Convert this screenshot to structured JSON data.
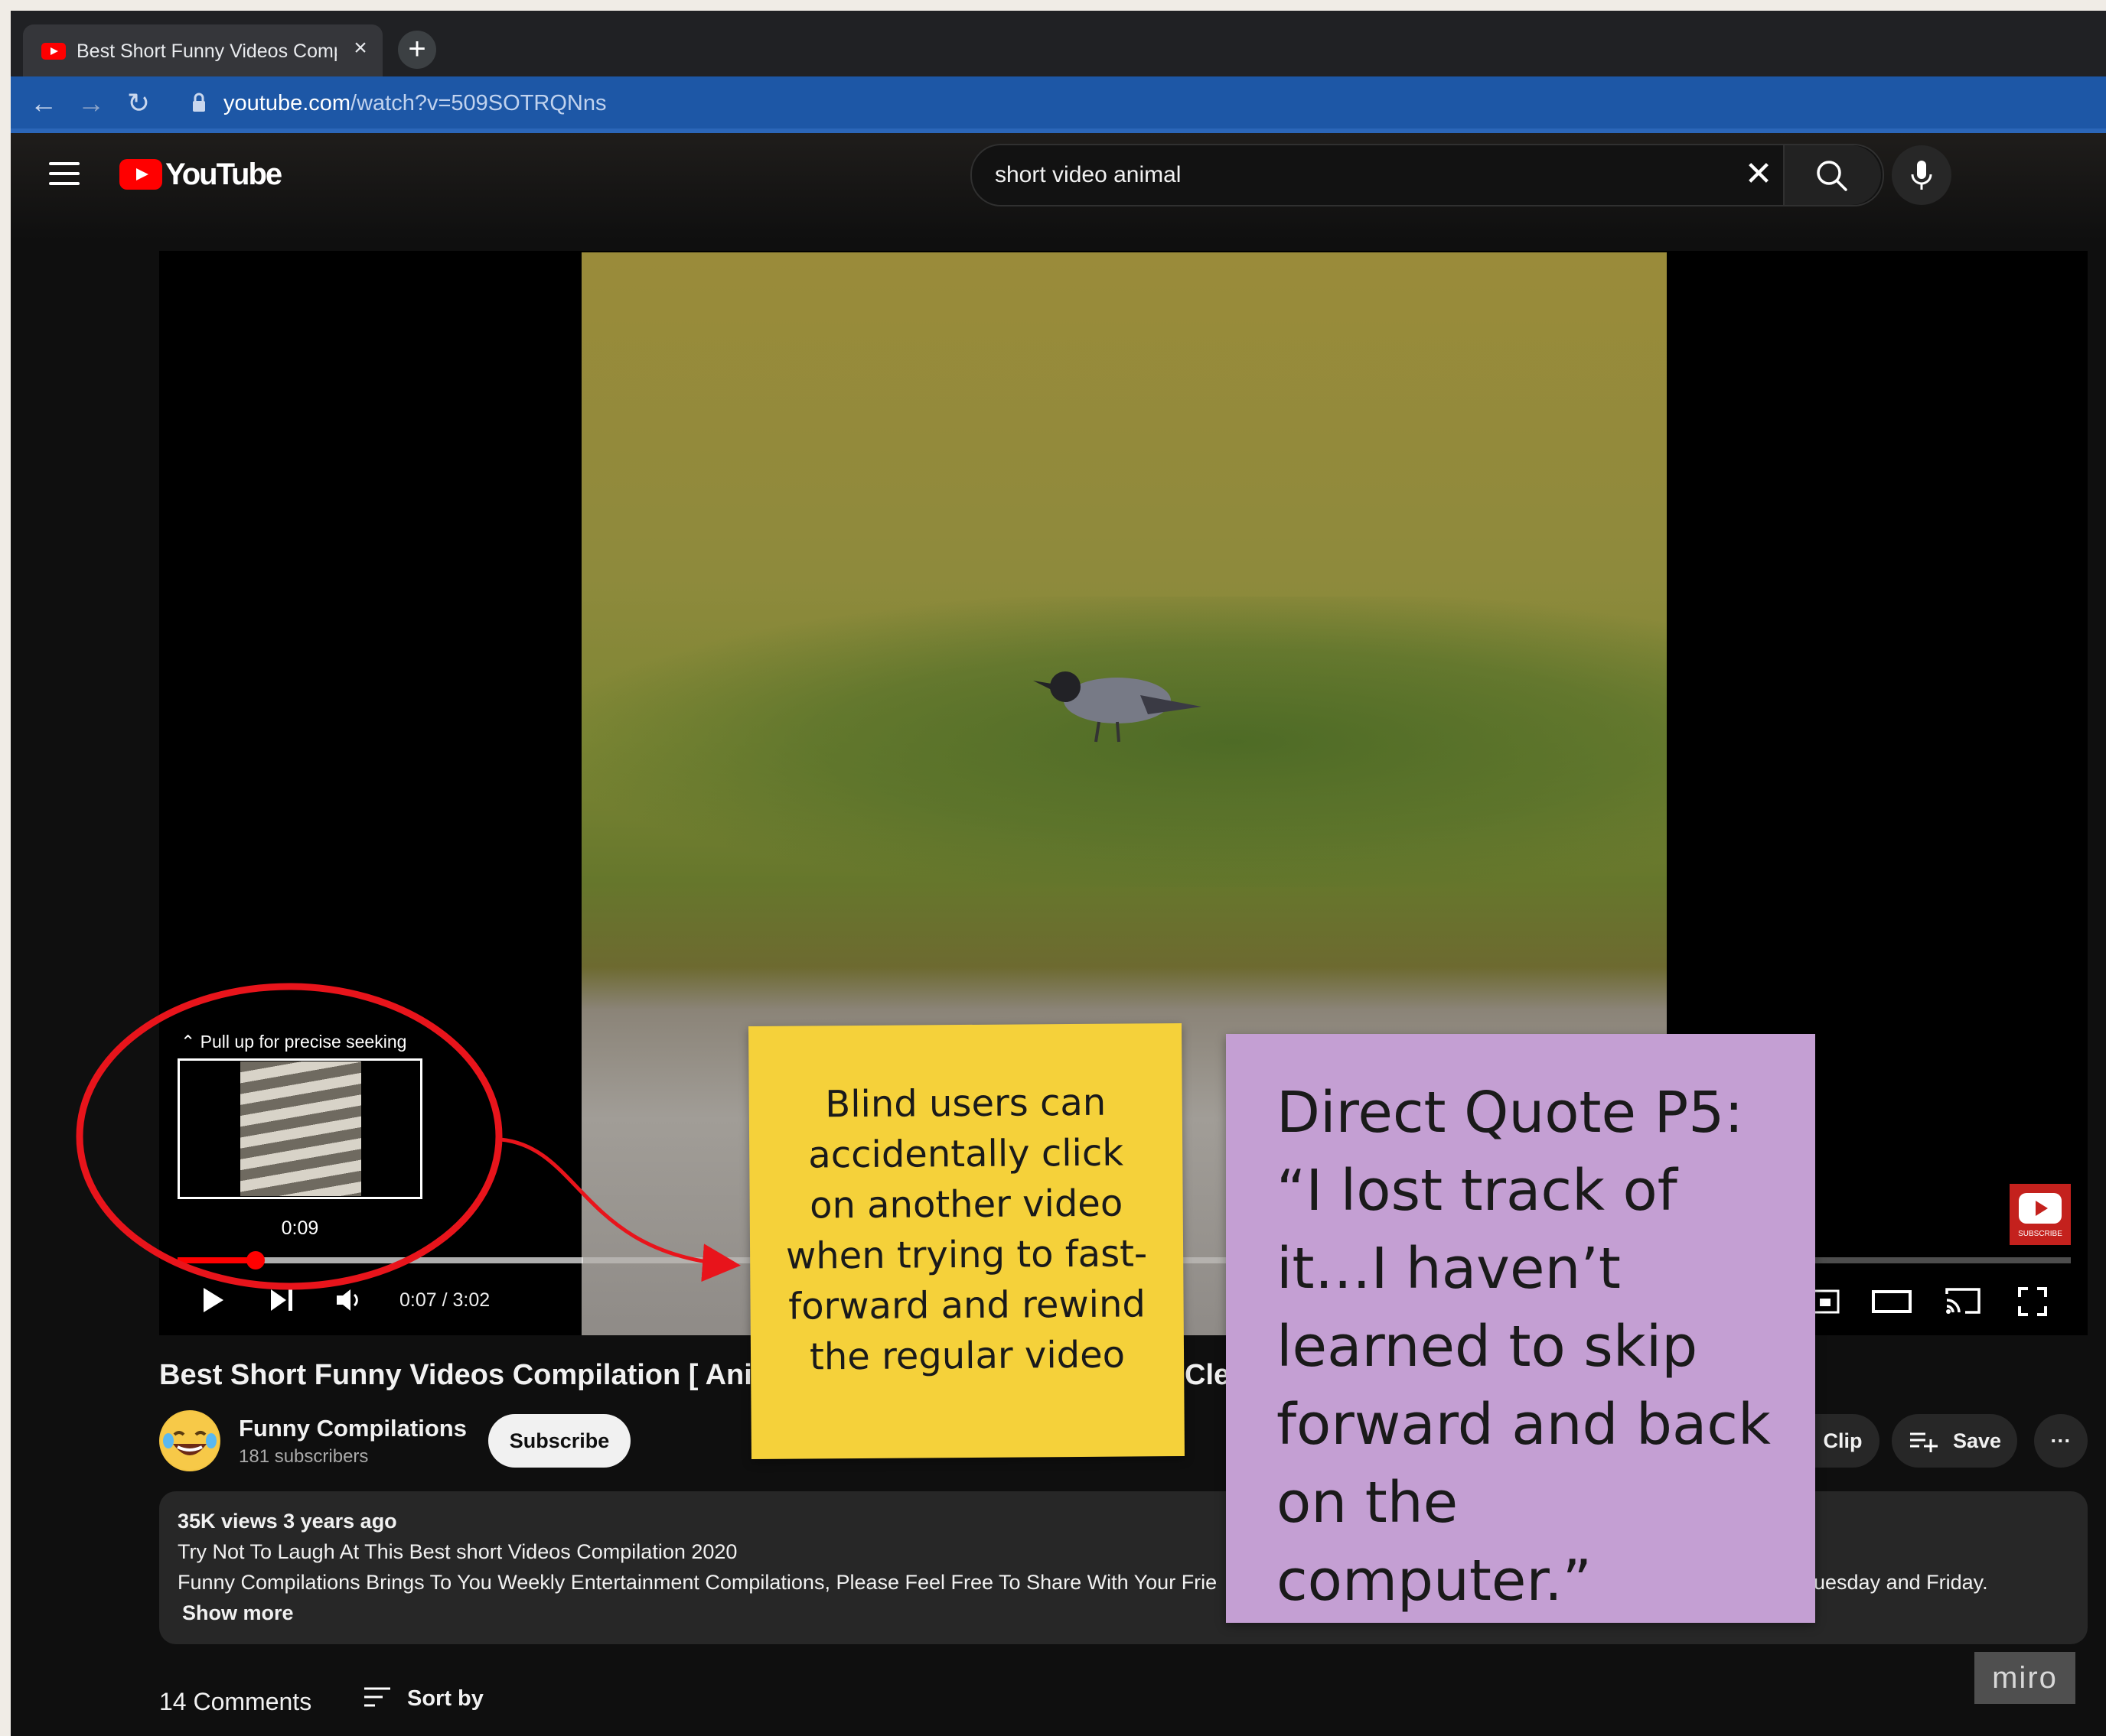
{
  "browser": {
    "tab_title": "Best Short Funny Videos Comp",
    "tab_close": "×",
    "new_tab": "+",
    "back": "←",
    "forward": "→",
    "reload": "↻",
    "url_domain": "youtube.com",
    "url_path": "/watch?v=509SOTRQNns"
  },
  "youtube": {
    "logo_text": "YouTube",
    "search_value": "short video animal",
    "search_clear": "✕"
  },
  "player": {
    "seek_hint": "⌃ Pull up for precise seeking",
    "seek_preview_time": "0:09",
    "time_display": "0:07 / 3:02",
    "progress_played_fraction": 0.04,
    "progress_buffered_fraction": 0.21,
    "watermark_label": "SUBSCRIBE"
  },
  "video": {
    "title": "Best Short Funny Videos Compilation [ Animal",
    "title_tail": "Cle",
    "channel_name": "Funny Compilations",
    "subscribers": "181 subscribers",
    "subscribe_label": "Subscribe",
    "clip_label": "Clip",
    "save_label": "Save",
    "more_label": "···"
  },
  "description": {
    "meta": "35K views  3 years ago",
    "line1": "Try Not To Laugh At This Best short Videos Compilation 2020",
    "line2": "Funny Compilations Brings To You Weekly Entertainment Compilations, Please Feel Free To Share  With Your Frie",
    "line2_tail": "uesday and Friday.",
    "show_more": "Show more"
  },
  "comments": {
    "count_label": "14 Comments",
    "sort_label": "Sort by"
  },
  "annotations": {
    "yellow_note": "Blind users can accidentally click on another video when trying to fast-forward and rewind the regular video",
    "purple_note": "Direct Quote P5: “I lost track of it…I haven’t learned to skip forward and back on the computer.”",
    "miro_badge": "miro"
  },
  "colors": {
    "yt_red": "#ff0000",
    "sticky_yellow": "#f5d13a",
    "sticky_purple": "#c49fd3",
    "annotation_red": "#e8141b"
  }
}
